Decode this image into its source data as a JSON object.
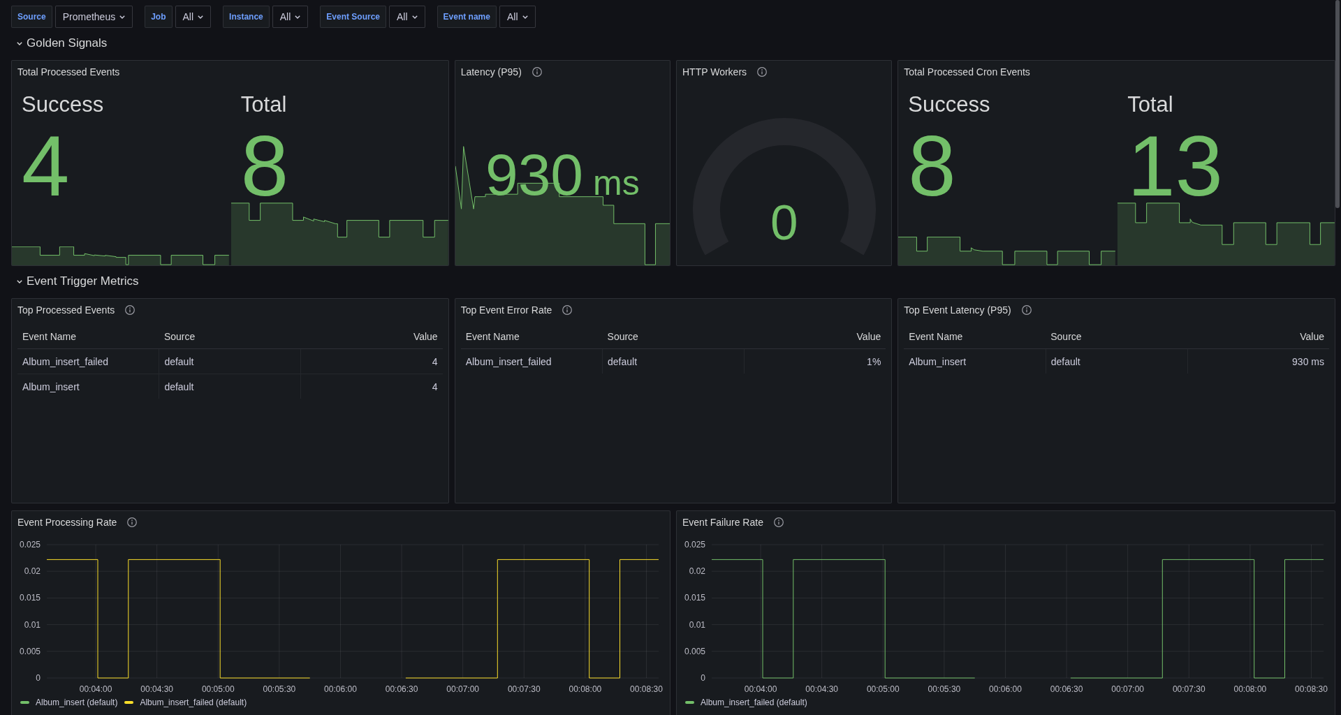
{
  "filters": [
    {
      "label": "Source",
      "value": "Prometheus"
    },
    {
      "label": "Job",
      "value": "All"
    },
    {
      "label": "Instance",
      "value": "All"
    },
    {
      "label": "Event Source",
      "value": "All"
    },
    {
      "label": "Event name",
      "value": "All"
    }
  ],
  "rows": [
    {
      "title": "Golden Signals",
      "expanded": true,
      "panels": [
        {
          "kind": "stat",
          "title": "Total Processed Events",
          "info": false,
          "stats": [
            {
              "label": "Success",
              "value": "4"
            },
            {
              "label": "Total",
              "value": "8"
            }
          ]
        },
        {
          "kind": "stat",
          "title": "Latency (P95)",
          "info": true,
          "stats": [
            {
              "value": "930",
              "unit": "ms"
            }
          ]
        },
        {
          "kind": "gauge",
          "title": "HTTP Workers",
          "info": true,
          "value": "0"
        },
        {
          "kind": "stat",
          "title": "Total Processed Cron Events",
          "info": false,
          "stats": [
            {
              "label": "Success",
              "value": "8"
            },
            {
              "label": "Total",
              "value": "13"
            }
          ]
        }
      ]
    },
    {
      "title": "Event Trigger Metrics",
      "expanded": true,
      "panels": [
        {
          "kind": "table",
          "title": "Top Processed Events",
          "info": true,
          "columns": [
            "Event Name",
            "Source",
            "Value"
          ],
          "rows": [
            [
              "Album_insert_failed",
              "default",
              "4"
            ],
            [
              "Album_insert",
              "default",
              "4"
            ]
          ]
        },
        {
          "kind": "table",
          "title": "Top Event Error Rate",
          "info": true,
          "columns": [
            "Event Name",
            "Source",
            "Value"
          ],
          "rows": [
            [
              "Album_insert_failed",
              "default",
              "1%"
            ]
          ]
        },
        {
          "kind": "table",
          "title": "Top Event Latency (P95)",
          "info": true,
          "columns": [
            "Event Name",
            "Source",
            "Value"
          ],
          "rows": [
            [
              "Album_insert",
              "default",
              "930 ms"
            ]
          ]
        },
        {
          "kind": "timeseries",
          "title": "Event Processing Rate",
          "info": true,
          "chart_data": {
            "type": "line",
            "grid": true,
            "legend": true,
            "x": [
              216,
              241,
              241,
              256,
              256,
              301,
              301,
              345,
              360,
              392,
              437,
              437,
              482,
              482,
              497,
              497,
              516
            ],
            "series": [
              {
                "name": "Album_insert (default)",
                "color": "#73bf69",
                "values": [
                  null,
                  null,
                  null,
                  null,
                  null,
                  null,
                  null,
                  null,
                  null,
                  null,
                  null,
                  null,
                  null,
                  null,
                  null,
                  null,
                  null
                ]
              },
              {
                "name": "Album_insert_failed (default)",
                "color": "#fade2a",
                "values": [
                  0.0222,
                  0.0222,
                  0,
                  0,
                  0.0222,
                  0.0222,
                  0,
                  0,
                  null,
                  0,
                  0,
                  0.0222,
                  0.0222,
                  0,
                  0,
                  0.0222,
                  0.0222
                ]
              }
            ],
            "xlim": [
              216,
              516
            ],
            "ylim": [
              0,
              0.025
            ],
            "xticks": [
              {
                "value": 240,
                "label": "00:04:00"
              },
              {
                "value": 270,
                "label": "00:04:30"
              },
              {
                "value": 300,
                "label": "00:05:00"
              },
              {
                "value": 330,
                "label": "00:05:30"
              },
              {
                "value": 360,
                "label": "00:06:00"
              },
              {
                "value": 390,
                "label": "00:06:30"
              },
              {
                "value": 420,
                "label": "00:07:00"
              },
              {
                "value": 450,
                "label": "00:07:30"
              },
              {
                "value": 480,
                "label": "00:08:00"
              },
              {
                "value": 510,
                "label": "00:08:30"
              }
            ],
            "yticks": [
              {
                "value": 0,
                "label": "0"
              },
              0.005,
              0.01,
              0.015,
              0.02,
              0.025
            ]
          }
        },
        {
          "kind": "timeseries",
          "title": "Event Failure Rate",
          "info": true,
          "chart_data": {
            "type": "line",
            "grid": true,
            "legend": true,
            "x": [
              216,
              241,
              241,
              256,
              256,
              301,
              301,
              345,
              360,
              392,
              437,
              437,
              482,
              482,
              497,
              497,
              516
            ],
            "series": [
              {
                "name": "Album_insert_failed (default)",
                "color": "#73bf69",
                "values": [
                  0.0222,
                  0.0222,
                  0,
                  0,
                  0.0222,
                  0.0222,
                  0,
                  0,
                  null,
                  0,
                  0,
                  0.0222,
                  0.0222,
                  0,
                  0,
                  0.0222,
                  0.0222
                ]
              }
            ],
            "xlim": [
              216,
              516
            ],
            "ylim": [
              0,
              0.025
            ],
            "xticks": [
              {
                "value": 240,
                "label": "00:04:00"
              },
              {
                "value": 270,
                "label": "00:04:30"
              },
              {
                "value": 300,
                "label": "00:05:00"
              },
              {
                "value": 330,
                "label": "00:05:30"
              },
              {
                "value": 360,
                "label": "00:06:00"
              },
              {
                "value": 390,
                "label": "00:06:30"
              },
              {
                "value": 420,
                "label": "00:07:00"
              },
              {
                "value": 450,
                "label": "00:07:30"
              },
              {
                "value": 480,
                "label": "00:08:00"
              },
              {
                "value": 510,
                "label": "00:08:30"
              }
            ],
            "yticks": [
              {
                "value": 0,
                "label": "0"
              },
              0.005,
              0.01,
              0.015,
              0.02,
              0.025
            ]
          }
        }
      ]
    }
  ]
}
